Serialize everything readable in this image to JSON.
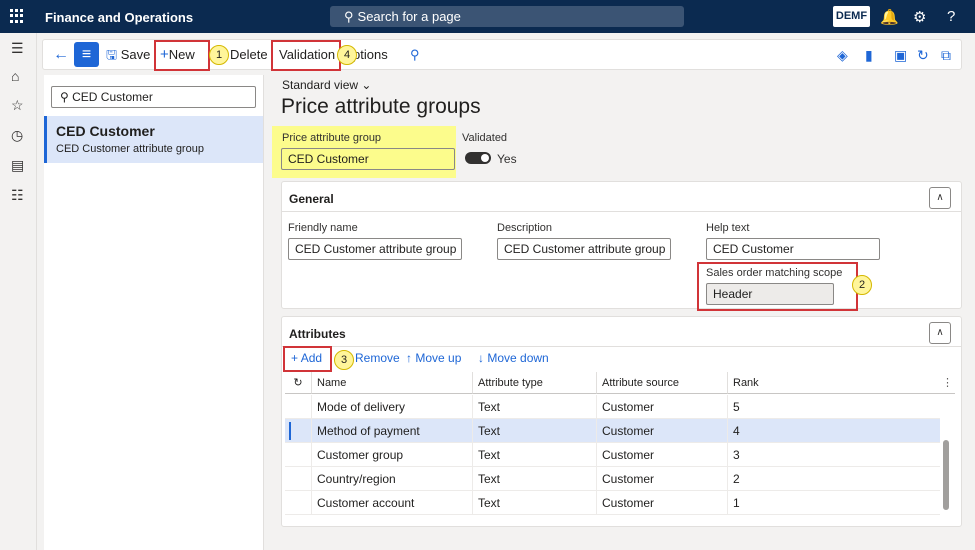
{
  "topbar": {
    "app_title": "Finance and Operations",
    "search_label": "Search for a page",
    "company": "DEMF"
  },
  "toolbar": {
    "save": "Save",
    "new": "New",
    "delete": "Delete",
    "validation": "Validation",
    "options": "ptions"
  },
  "callouts": {
    "c1": "1",
    "c2": "2",
    "c3": "3",
    "c4": "4"
  },
  "list": {
    "filter_value": "CED Customer",
    "items": [
      {
        "title": "CED Customer",
        "subtitle": "CED Customer attribute group"
      }
    ]
  },
  "page": {
    "view": "Standard view",
    "title": "Price attribute groups"
  },
  "header_fields": {
    "group_label": "Price attribute group",
    "group_value": "CED Customer",
    "validated_label": "Validated",
    "validated_value": "Yes"
  },
  "general": {
    "title": "General",
    "friendly_label": "Friendly name",
    "friendly_value": "CED Customer attribute group",
    "desc_label": "Description",
    "desc_value": "CED Customer attribute group",
    "help_label": "Help text",
    "help_value": "CED Customer",
    "scope_label": "Sales order matching scope",
    "scope_value": "Header"
  },
  "attributes": {
    "title": "Attributes",
    "add": "Add",
    "remove": "Remove",
    "move_up": "Move up",
    "move_down": "Move down",
    "columns": [
      "Name",
      "Attribute type",
      "Attribute source",
      "Rank"
    ],
    "rows": [
      [
        "Mode of delivery",
        "Text",
        "Customer",
        "5"
      ],
      [
        "Method of payment",
        "Text",
        "Customer",
        "4"
      ],
      [
        "Customer group",
        "Text",
        "Customer",
        "3"
      ],
      [
        "Country/region",
        "Text",
        "Customer",
        "2"
      ],
      [
        "Customer account",
        "Text",
        "Customer",
        "1"
      ]
    ]
  },
  "colors": {
    "topbar": "#0b2a50",
    "accent": "#1e66d6",
    "highlight": "#fcfc8c",
    "callout": "#d13438"
  }
}
